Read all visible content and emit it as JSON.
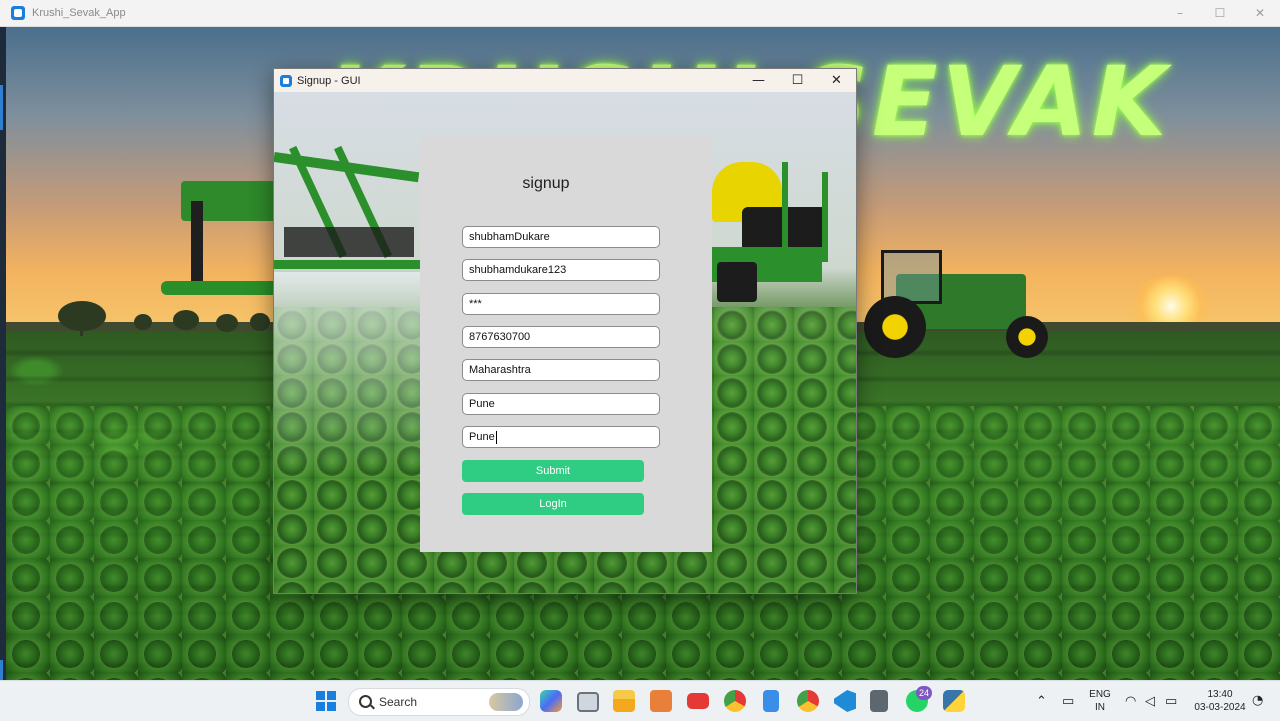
{
  "app_window": {
    "title": "Krushi_Sevak_App",
    "controls": {
      "minimize": "–",
      "maximize": "☐",
      "close": "✕"
    }
  },
  "background": {
    "headline": "KRUSHI SEVAK"
  },
  "signup_window": {
    "title": "Signup - GUI",
    "controls": {
      "minimize": "—",
      "maximize": "☐",
      "close": "✕"
    },
    "form": {
      "title": "signup",
      "fields": [
        {
          "name": "username",
          "value": "shubhamDukare"
        },
        {
          "name": "email",
          "value": "shubhamdukare123"
        },
        {
          "name": "password",
          "value": "***"
        },
        {
          "name": "phone",
          "value": "8767630700"
        },
        {
          "name": "state",
          "value": "Maharashtra"
        },
        {
          "name": "district",
          "value": "Pune"
        },
        {
          "name": "city",
          "value": "Pune"
        }
      ],
      "submit_label": "Submit",
      "login_label": "LogIn"
    }
  },
  "taskbar": {
    "search_label": "Search",
    "whatsapp_badge": "24",
    "language": {
      "line1": "ENG",
      "line2": "IN"
    },
    "clock": {
      "time": "13:40",
      "date": "03-03-2024"
    },
    "icons": [
      "start-icon",
      "search-icon",
      "copilot-icon",
      "task-view-icon",
      "file-explorer-icon",
      "app-icon",
      "youtube-icon",
      "chrome-icon",
      "notepad-icon",
      "chrome-profile-icon",
      "vscode-icon",
      "calculator-icon",
      "whatsapp-icon",
      "python-app-icon"
    ],
    "colors": {
      "accent": "#1a7de0",
      "button_green": "#2fcc83",
      "headline_green": "#c6ff7a"
    }
  }
}
